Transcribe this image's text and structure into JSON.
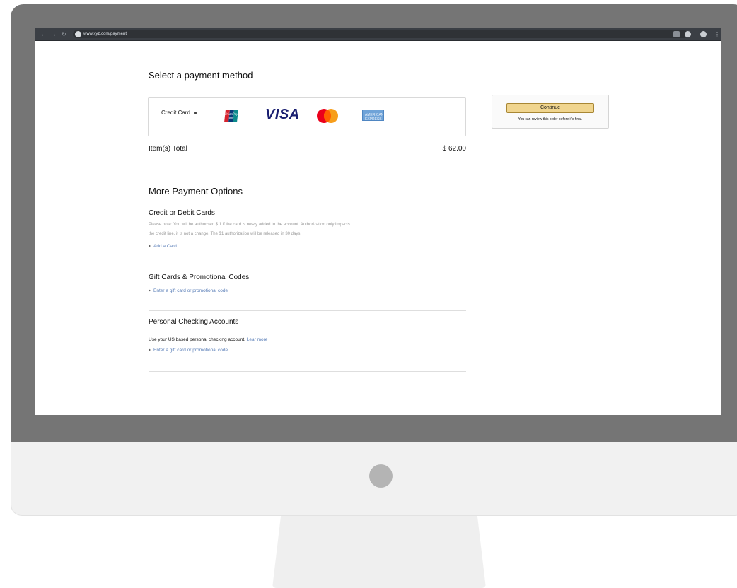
{
  "browser": {
    "url": "www.xyz.com/payment"
  },
  "payment": {
    "title": "Select a payment method",
    "credit_card_label": "Credit Card",
    "brands": {
      "unionpay": "UnionPay",
      "visa": "VISA",
      "mastercard": "Mastercard",
      "amex": "AMERICAN EXPRESS"
    },
    "items_total_label": "Item(s) Total",
    "items_total_value": "$ 62.00"
  },
  "sidebar": {
    "continue_label": "Continue",
    "review_note": "You can review this order before it's final."
  },
  "more_options": {
    "title": "More Payment Options",
    "credit_debit": {
      "heading": "Credit or Debit Cards",
      "note_line1": "Please note: You will be authorised $ 1 if the card is newly added to the account. Authorization only impacts",
      "note_line2": "the credit line, it is not a change. The $1 authorization will be released in 30 days.",
      "link": "Add a Card"
    },
    "gift_cards": {
      "heading": "Gift Cards & Promotional Codes",
      "link": "Enter a gift card or promotional code"
    },
    "checking": {
      "heading": "Personal Checking Accounts",
      "description": "Use your US based personal checking account.",
      "learn_more": "Lear more",
      "link": "Enter a gift card or promotional code"
    }
  },
  "colors": {
    "bezel": "#757575",
    "continue_button": "#f0d58f",
    "link": "#5b7fb8",
    "visa": "#1a1f71"
  }
}
